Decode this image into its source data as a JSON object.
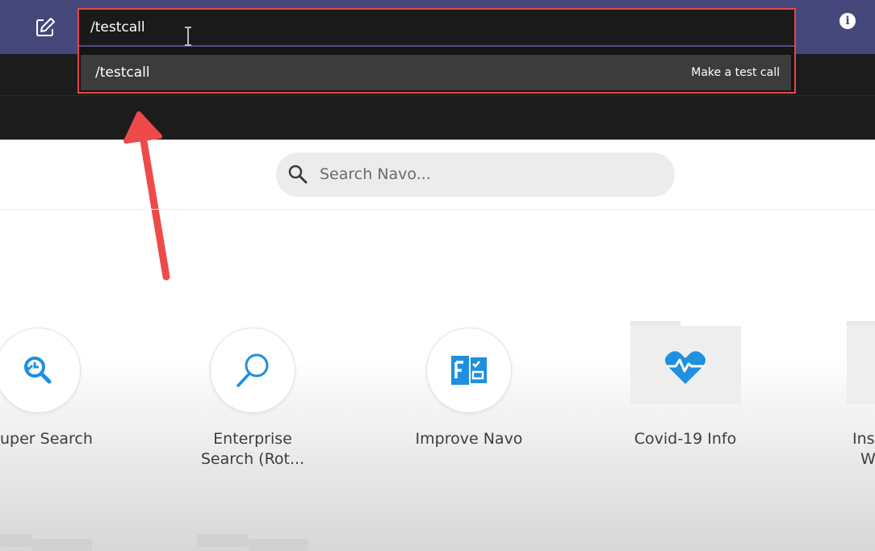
{
  "command_bar": {
    "input_value": "/testcall",
    "suggestion": {
      "command": "/testcall",
      "description": "Make a test call"
    }
  },
  "search": {
    "placeholder": "Search Navo..."
  },
  "tiles": [
    {
      "label_line1": "uper Search",
      "label_line2": ""
    },
    {
      "label_line1": "Enterprise",
      "label_line2": "Search (Rot..."
    },
    {
      "label_line1": "Improve Navo",
      "label_line2": ""
    },
    {
      "label_line1": "Covid-19 Info",
      "label_line2": ""
    },
    {
      "label_line1": "Ins",
      "label_line2": "W"
    }
  ],
  "icons": {
    "compose": "compose-icon",
    "info": "info-icon",
    "search": "search-icon",
    "tile_0": "history-search-icon",
    "tile_1": "magnifier-icon",
    "tile_2": "forms-icon",
    "tile_3": "heartbeat-icon"
  },
  "colors": {
    "topbar": "#46477a",
    "highlight": "#e04848",
    "accent_blue": "#1f8fe0"
  }
}
